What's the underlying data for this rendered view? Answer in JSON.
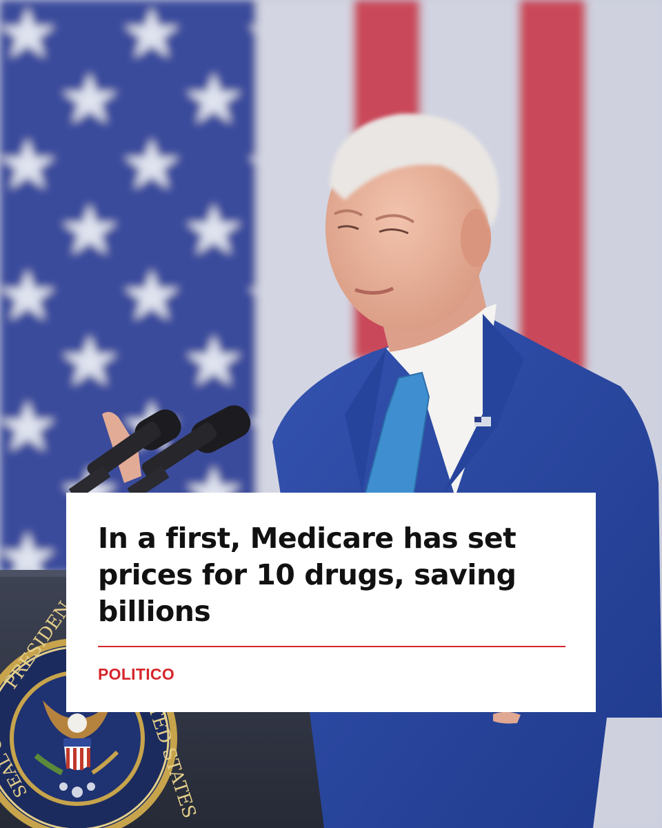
{
  "headline": "In a first, Medicare has set prices for 10 drugs, saving billions",
  "source": "POLITICO",
  "seal": {
    "text_left": "PRESIDEN",
    "text_right": "TED STATES",
    "text_bottom": "SEAL OF THE"
  },
  "colors": {
    "accent": "#d5252b",
    "card_background": "#ffffff",
    "headline_text": "#111111",
    "flag_blue": "#3a4c9c",
    "flag_red": "#c94a5a",
    "suit_blue": "#2c4aa6",
    "tie_blue": "#3f8fd0"
  }
}
